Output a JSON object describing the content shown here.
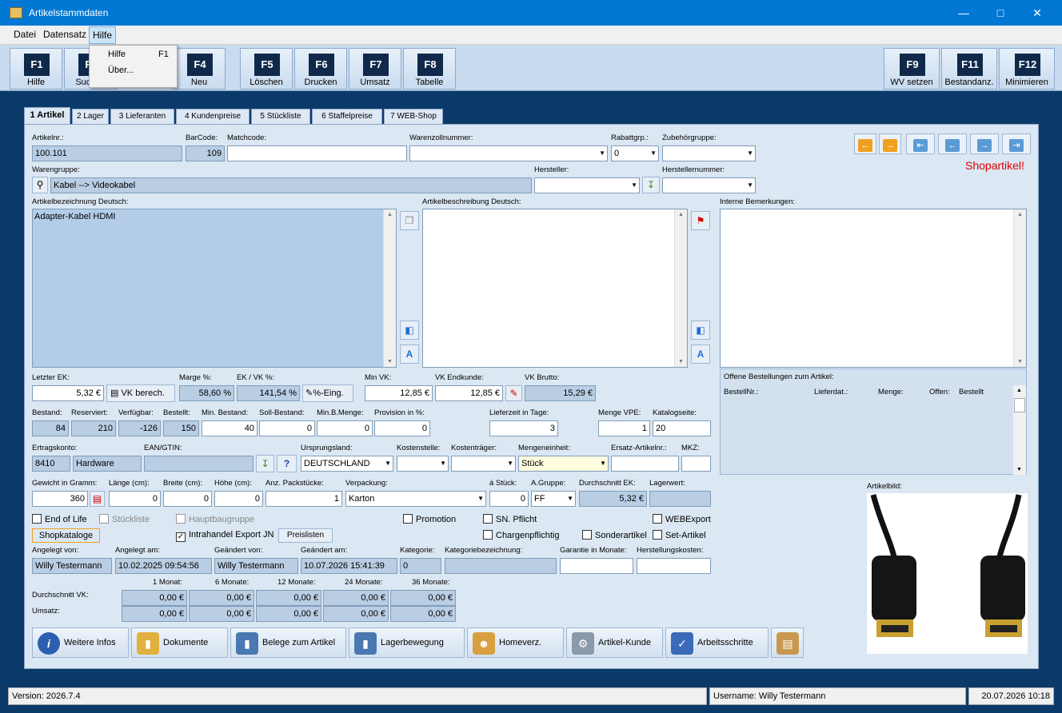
{
  "window": {
    "title": "Artikelstammdaten"
  },
  "menu": {
    "items": [
      "Datei",
      "Datensatz",
      "Hilfe"
    ],
    "dropdown": [
      {
        "label": "Hilfe",
        "shortcut": "F1"
      },
      {
        "label": "Über...",
        "shortcut": ""
      }
    ]
  },
  "toolbar": {
    "left": [
      {
        "key": "F1",
        "label": "Hilfe"
      },
      {
        "key": "F3",
        "label": "Suchen"
      },
      {
        "key": "F4",
        "label": "Neu"
      },
      {
        "key": "F5",
        "label": "Löschen"
      },
      {
        "key": "F6",
        "label": "Drucken"
      },
      {
        "key": "F7",
        "label": "Umsatz"
      },
      {
        "key": "F8",
        "label": "Tabelle"
      }
    ],
    "right": [
      {
        "key": "F9",
        "label": "WV setzen"
      },
      {
        "key": "F11",
        "label": "Bestandanz."
      },
      {
        "key": "F12",
        "label": "Minimieren"
      }
    ]
  },
  "tabs": [
    "1 Artikel",
    "2 Lager",
    "3 Lieferanten",
    "4 Kundenpreise",
    "5 Stückliste",
    "6 Staffelpreise",
    "7 WEB-Shop"
  ],
  "labels": {
    "artikelnr": "Artikelnr.:",
    "barcode": "BarCode:",
    "matchcode": "Matchcode:",
    "warenzoll": "Warenzollnummer:",
    "rabattgrp": "Rabattgrp.:",
    "zubehoer": "Zubehörgruppe:",
    "warengruppe": "Warengruppe:",
    "hersteller": "Hersteller:",
    "herstellernr": "Herstellernummer:",
    "bez_de": "Artikelbezeichnung Deutsch:",
    "beschr_de": "Artikelbeschreibung Deutsch:",
    "interne": "Interne Bemerkungen:",
    "letzter_ek": "Letzter EK:",
    "marge": "Marge %:",
    "ekvk": "EK / VK %:",
    "minvk": "Min VK:",
    "vkend": "VK Endkunde:",
    "vkbrutto": "VK Brutto:",
    "offene": "Offene Bestellungen zum Artikel:",
    "bestand": "Bestand:",
    "reserviert": "Reserviert:",
    "verfuegbar": "Verfügbar:",
    "bestellt": "Bestellt:",
    "minbestand": "Min. Bestand:",
    "sollbestand": "Soll-Bestand:",
    "minbmenge": "Min.B.Menge:",
    "provision": "Provision in %:",
    "lieferzeit": "Lieferzeit in Tage:",
    "mengevpe": "Menge VPE:",
    "katalogseite": "Katalogseite:",
    "ertragskonto": "Ertragskonto:",
    "ean": "EAN/GTIN:",
    "ursprung": "Ursprungsland:",
    "kostenstelle": "Kostenstelle:",
    "kostentraeger": "Kostenträger:",
    "mengeneinheit": "Mengeneinheit:",
    "ersatz": "Ersatz-Artikelnr.:",
    "mkz": "MKZ:",
    "gewicht": "Gewicht in Gramm:",
    "laenge": "Länge (cm):",
    "breite": "Breite (cm):",
    "hoehe": "Höhe (cm):",
    "packstuecke": "Anz. Packstücke:",
    "verpackung": "Verpackung:",
    "astueck": "á Stück:",
    "agruppe": "A.Gruppe:",
    "durchschnittek": "Durchschnitt EK:",
    "lagerwert": "Lagerwert:",
    "artikelbild": "Artikelbild:",
    "angelegtvon": "Angelegt von:",
    "angelegtam": "Angelegt am:",
    "geaendertvon": "Geändert von:",
    "geaendertam": "Geändert am:",
    "kategorie": "Kategorie:",
    "kategoriebez": "Kategoriebezeichnung:",
    "garantie": "Garantie in Monate:",
    "herstellkosten": "Herstellungskosten:",
    "durchschnittvk": "Durchschnitt VK:",
    "umsatz": "Umsatz:",
    "shopartikel": "Shopartikel!"
  },
  "values": {
    "artikelnr": "100.101",
    "barcode": "109",
    "matchcode": "",
    "rabattgrp": "0",
    "warengruppe": "Kabel --> Videokabel",
    "bez_de": "Adapter-Kabel HDMI",
    "letzter_ek": "5,32 €",
    "marge": "58,60 %",
    "ekvk": "141,54 %",
    "minvk": "12,85 €",
    "vkend": "12,85 €",
    "vkbrutto": "15,29 €",
    "bestand": "84",
    "reserviert": "210",
    "verfuegbar": "-126",
    "bestellt": "150",
    "minbestand": "40",
    "sollbestand": "0",
    "minbmenge": "0",
    "provision": "0",
    "lieferzeit": "3",
    "mengevpe": "1",
    "katalogseite": "20",
    "ertragskonto": "8410",
    "ertragsname": "Hardware",
    "ursprung": "DEUTSCHLAND",
    "mengeneinheit": "Stück",
    "gewicht": "360",
    "laenge": "0",
    "breite": "0",
    "hoehe": "0",
    "packstuecke": "1",
    "verpackung": "Karton",
    "astueck": "0",
    "agruppe": "FF",
    "durchschnittek": "5,32 €",
    "angelegtvon": "Willy Testermann",
    "angelegtam": "10.02.2025 09:54:56",
    "geaendertvon": "Willy Testermann",
    "geaendertam": "10.07.2026 15:41:39",
    "kategorie": "0"
  },
  "buttons": {
    "vkberech": "VK berech.",
    "prozeing": "%-Eing.",
    "shopkataloge": "Shopkataloge",
    "preislisten": "Preislisten"
  },
  "checkboxes": [
    {
      "label": "End of Life",
      "checked": false
    },
    {
      "label": "Stückliste",
      "checked": false
    },
    {
      "label": "Hauptbaugruppe",
      "checked": false
    },
    {
      "label": "Intrahandel Export JN",
      "checked": true
    },
    {
      "label": "Promotion",
      "checked": false
    },
    {
      "label": "SN. Pflicht",
      "checked": false
    },
    {
      "label": "Chargenpflichtig",
      "checked": false
    },
    {
      "label": "Sonderartikel",
      "checked": false
    },
    {
      "label": "WEBExport",
      "checked": false
    },
    {
      "label": "Set-Artikel",
      "checked": false
    }
  ],
  "orders_table": {
    "columns": [
      "BestellNr.:",
      "Lieferdat.:",
      "Menge:",
      "Offen:",
      "Bestellt"
    ]
  },
  "stats": {
    "months": [
      "1 Monat:",
      "6 Monate:",
      "12 Monate:",
      "24 Monate:",
      "36 Monate:"
    ],
    "vk": [
      "0,00 €",
      "0,00 €",
      "0,00 €",
      "0,00 €",
      "0,00 €"
    ],
    "umsatz": [
      "0,00 €",
      "0,00 €",
      "0,00 €",
      "0,00 €",
      "0,00 €"
    ]
  },
  "bottom_buttons": [
    "Weitere Infos",
    "Dokumente",
    "Belege zum Artikel",
    "Lagerbewegung",
    "Homeverz.",
    "Artikel-Kunde",
    "Arbeitsschritte"
  ],
  "status": {
    "version": "Version: 2026.7.4",
    "user": "Username: Willy Testermann",
    "datetime": "20.07.2026 10:18"
  },
  "colors": {
    "titlebar": "#0078d4",
    "panel": "#dbe7f3",
    "accent_orange": "#f0a020",
    "shop_red": "#e00000"
  }
}
